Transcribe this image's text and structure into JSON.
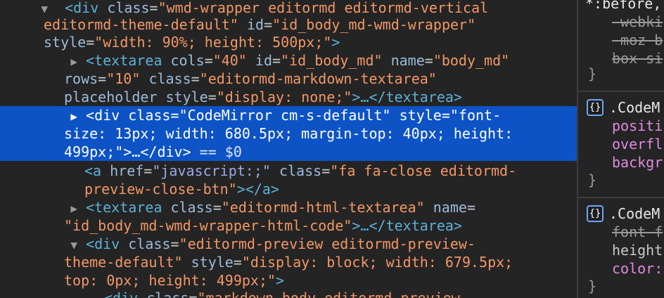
{
  "elements_panel": {
    "line1": {
      "arrow": "▼",
      "open": "<div ",
      "a1": "class",
      "v1": "\"wmd-wrapper editormd editormd-vertical"
    },
    "line2": {
      "v1cont": "editormd-theme-default\"",
      "a2": "id",
      "v2": "\"id_body_md-wmd-wrapper\""
    },
    "line3": {
      "a3": "style",
      "v3": "\"width: 90%; height: 500px;\"",
      "close": ">"
    },
    "line4": {
      "arrow": "▶",
      "open": "<textarea ",
      "a1": "cols",
      "v1": "\"40\"",
      "a2": "id",
      "v2": "\"id_body_md\"",
      "a3": "name",
      "v3": "\"body_md\""
    },
    "line5": {
      "a4": "rows",
      "v4": "\"10\"",
      "a5": "class",
      "v5": "\"editormd-markdown-textarea\""
    },
    "line6": {
      "a6": "placeholder",
      "a7": "style",
      "v7": "\"display: none;\"",
      "mid": ">…",
      "close": "</textarea>"
    },
    "line7": {
      "arrow": "▶",
      "open": "<div ",
      "a1": "class",
      "v1": "\"CodeMirror cm-s-default\"",
      "a2": "style",
      "v2": "\"font-"
    },
    "line8": {
      "v2cont": "size: 13px; width: 680.5px; margin-top: 40px; height:"
    },
    "line9": {
      "v2end": "499px;\"",
      "mid": ">…",
      "close": "</div>",
      "ref": " == $0"
    },
    "line10": {
      "open": "<a ",
      "a1": "href",
      "v1": "\"javascript:;\"",
      "a2": "class",
      "v2": "\"fa fa-close editormd-"
    },
    "line11": {
      "v2cont": "preview-close-btn\"",
      "close": "></a>"
    },
    "line12": {
      "arrow": "▶",
      "open": "<textarea ",
      "a1": "class",
      "v1": "\"editormd-html-textarea\"",
      "a2": "name"
    },
    "line13": {
      "v2": "\"id_body_md-wmd-wrapper-html-code\"",
      "mid": ">…",
      "close": "</textarea>"
    },
    "line14": {
      "arrow": "▼",
      "open": "<div ",
      "a1": "class",
      "v1": "\"editormd-preview editormd-preview-"
    },
    "line15": {
      "v1cont": "theme-default\"",
      "a2": "style",
      "v2": "\"display: block; width: 679.5px;"
    },
    "line16": {
      "v2cont": "top: 0px; height: 499px;\"",
      "close": ">"
    },
    "line17": {
      "open": "<div ",
      "a1": "class",
      "v1": "\"markdown-body editormd-preview-"
    }
  },
  "styles_panel": {
    "rule0": {
      "selector": "*:before,",
      "decls": [
        "-webki",
        "-moz-b",
        "box-si"
      ],
      "close": "}"
    },
    "rule1": {
      "icon": "{}",
      "selector": ".CodeM",
      "decls": [
        "positi",
        "overfl",
        "backgr"
      ],
      "close": "}"
    },
    "rule2": {
      "icon": "{}",
      "selector": ".CodeM",
      "decls": [
        "font-f",
        "height",
        "color:"
      ],
      "close": "}"
    }
  }
}
